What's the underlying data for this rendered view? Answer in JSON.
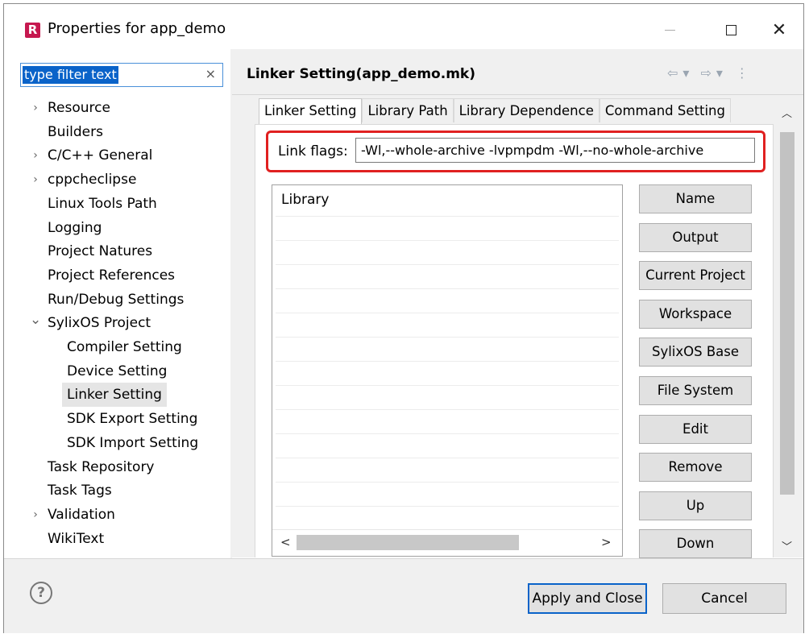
{
  "window": {
    "title": "Properties for app_demo",
    "app_icon_letter": "R",
    "controls": [
      "minimize",
      "maximize",
      "close"
    ]
  },
  "filter": {
    "value": "type filter text",
    "clear_glyph": "×"
  },
  "tree": [
    {
      "label": "Resource",
      "expandable": true,
      "expanded": false,
      "level": 0
    },
    {
      "label": "Builders",
      "expandable": false,
      "level": 0
    },
    {
      "label": "C/C++ General",
      "expandable": true,
      "expanded": false,
      "level": 0
    },
    {
      "label": "cppcheclipse",
      "expandable": true,
      "expanded": false,
      "level": 0
    },
    {
      "label": "Linux Tools Path",
      "expandable": false,
      "level": 0
    },
    {
      "label": "Logging",
      "expandable": false,
      "level": 0
    },
    {
      "label": "Project Natures",
      "expandable": false,
      "level": 0
    },
    {
      "label": "Project References",
      "expandable": false,
      "level": 0
    },
    {
      "label": "Run/Debug Settings",
      "expandable": false,
      "level": 0
    },
    {
      "label": "SylixOS Project",
      "expandable": true,
      "expanded": true,
      "level": 0
    },
    {
      "label": "Compiler Setting",
      "expandable": false,
      "level": 1
    },
    {
      "label": "Device Setting",
      "expandable": false,
      "level": 1
    },
    {
      "label": "Linker Setting",
      "expandable": false,
      "level": 1,
      "selected": true
    },
    {
      "label": "SDK Export Setting",
      "expandable": false,
      "level": 1
    },
    {
      "label": "SDK Import Setting",
      "expandable": false,
      "level": 1
    },
    {
      "label": "Task Repository",
      "expandable": false,
      "level": 0
    },
    {
      "label": "Task Tags",
      "expandable": false,
      "level": 0
    },
    {
      "label": "Validation",
      "expandable": true,
      "expanded": false,
      "level": 0
    },
    {
      "label": "WikiText",
      "expandable": false,
      "level": 0
    }
  ],
  "page": {
    "title": "Linker Setting(app_demo.mk)",
    "tabs": [
      {
        "label": "Linker Setting",
        "active": true
      },
      {
        "label": "Library Path",
        "active": false
      },
      {
        "label": "Library Dependence",
        "active": false
      },
      {
        "label": "Command Setting",
        "active": false
      }
    ],
    "link_flags_label": "Link flags:",
    "link_flags_value": "-Wl,--whole-archive -lvpmpdm -Wl,--no-whole-archive",
    "library_header": "Library",
    "buttons": [
      "Name",
      "Output",
      "Current Project",
      "Workspace",
      "SylixOS Base",
      "File System",
      "Edit",
      "Remove",
      "Up",
      "Down"
    ],
    "scroll": {
      "left": "<",
      "right": ">",
      "up": "^",
      "down": "v"
    }
  },
  "footer": {
    "help": "?",
    "apply": "Apply and Close",
    "cancel": "Cancel"
  },
  "colors": {
    "highlight_box": "#e02020",
    "selection": "#0a63c9",
    "pane_bg": "#f0f0f0"
  }
}
